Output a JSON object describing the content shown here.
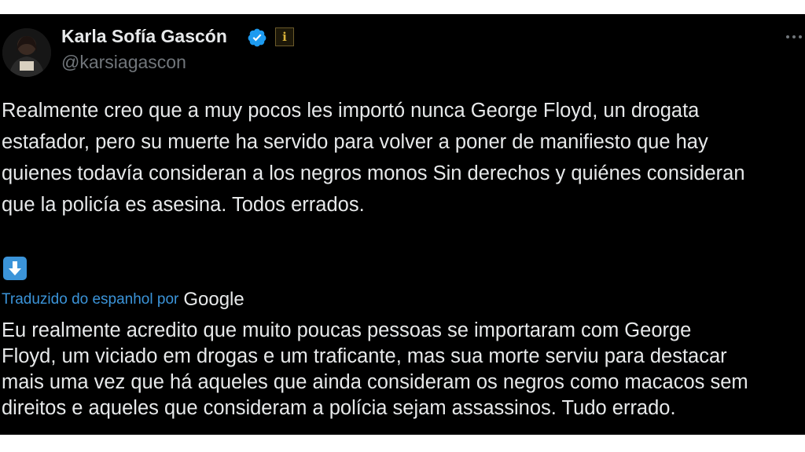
{
  "tweet": {
    "author_name": "Karla Sofía Gascón",
    "handle": "@karsiagascon",
    "affiliation_badge": "i",
    "icons": {
      "avatar": "avatar",
      "verified": "verified-badge-icon",
      "more": "more-options-icon",
      "translate": "down-arrow-icon"
    },
    "text": "Realmente creo que a muy pocos les importó nunca George Floyd, un drogata\nestafador, pero su muerte ha servido para volver a poner de manifiesto que hay\nquienes todavía consideran a los negros monos Sin derechos y quiénes consideran\nque la policía es asesina. Todos errados.",
    "translated_by_label": "Traduzido do espanhol por",
    "translator_name": "Google",
    "translation_text": "Eu realmente acredito que muito poucas pessoas se importaram com George\nFloyd, um viciado em drogas e um traficante, mas sua morte serviu para destacar\nmais uma vez que há aqueles que ainda consideram os negros como macacos sem\ndireitos e aqueles que consideram a polícia sejam assassinos. Tudo errado."
  },
  "colors": {
    "background": "#000000",
    "text": "#e7e9ea",
    "secondary_text": "#71767b",
    "accent_blue": "#3b94d9",
    "verified_blue": "#1d9bf0"
  }
}
